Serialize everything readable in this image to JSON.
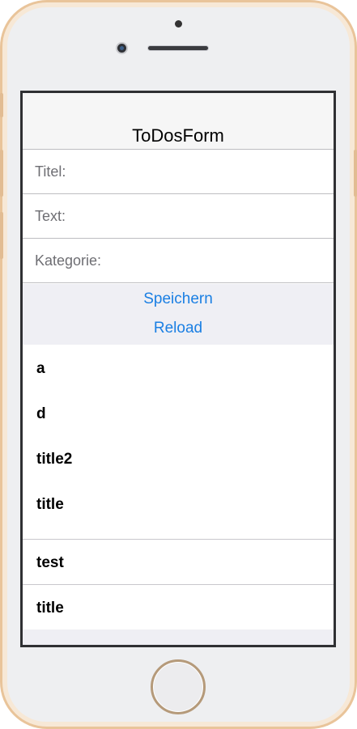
{
  "app": {
    "title": "ToDosForm"
  },
  "form": {
    "fields": [
      {
        "label": "Titel:",
        "value": "",
        "placeholder": ""
      },
      {
        "label": "Text:",
        "value": "",
        "placeholder": ""
      },
      {
        "label": "Kategorie:",
        "value": "",
        "placeholder": ""
      }
    ]
  },
  "actions": {
    "save_label": "Speichern",
    "reload_label": "Reload"
  },
  "todos": [
    {
      "title": "a"
    },
    {
      "title": "d"
    },
    {
      "title": "title2"
    },
    {
      "title": "title"
    },
    {
      "title": "test"
    },
    {
      "title": "title"
    }
  ],
  "colors": {
    "accent": "#1a7fe3",
    "nav_background": "#f6f6f6",
    "section_background": "#efeff4",
    "phone_frame": "#e9c49a"
  }
}
